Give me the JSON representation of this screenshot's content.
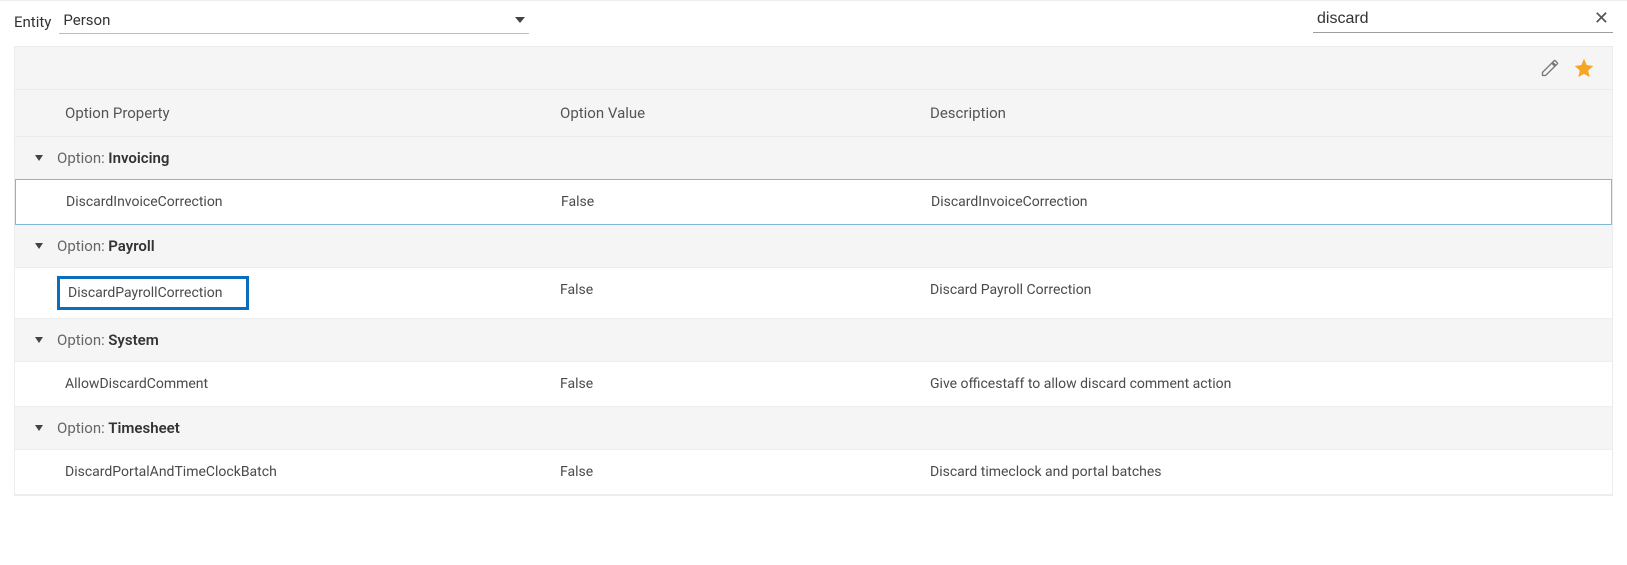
{
  "filter": {
    "entity_label": "Entity",
    "entity_value": "Person",
    "search_value": "discard"
  },
  "headers": {
    "property": "Option Property",
    "value": "Option Value",
    "description": "Description"
  },
  "group_prefix": "Option:",
  "groups": [
    {
      "name": "Invoicing",
      "selected": true,
      "rows": [
        {
          "property": "DiscardInvoiceCorrection",
          "value": "False",
          "description": "DiscardInvoiceCorrection",
          "highlight": false
        }
      ]
    },
    {
      "name": "Payroll",
      "selected": false,
      "rows": [
        {
          "property": "DiscardPayrollCorrection",
          "value": "False",
          "description": "Discard Payroll Correction",
          "highlight": true
        }
      ]
    },
    {
      "name": "System",
      "selected": false,
      "rows": [
        {
          "property": "AllowDiscardComment",
          "value": "False",
          "description": "Give officestaff to allow discard comment action",
          "highlight": false
        }
      ]
    },
    {
      "name": "Timesheet",
      "selected": false,
      "rows": [
        {
          "property": "DiscardPortalAndTimeClockBatch",
          "value": "False",
          "description": "Discard timeclock and portal batches",
          "highlight": false
        }
      ]
    }
  ]
}
